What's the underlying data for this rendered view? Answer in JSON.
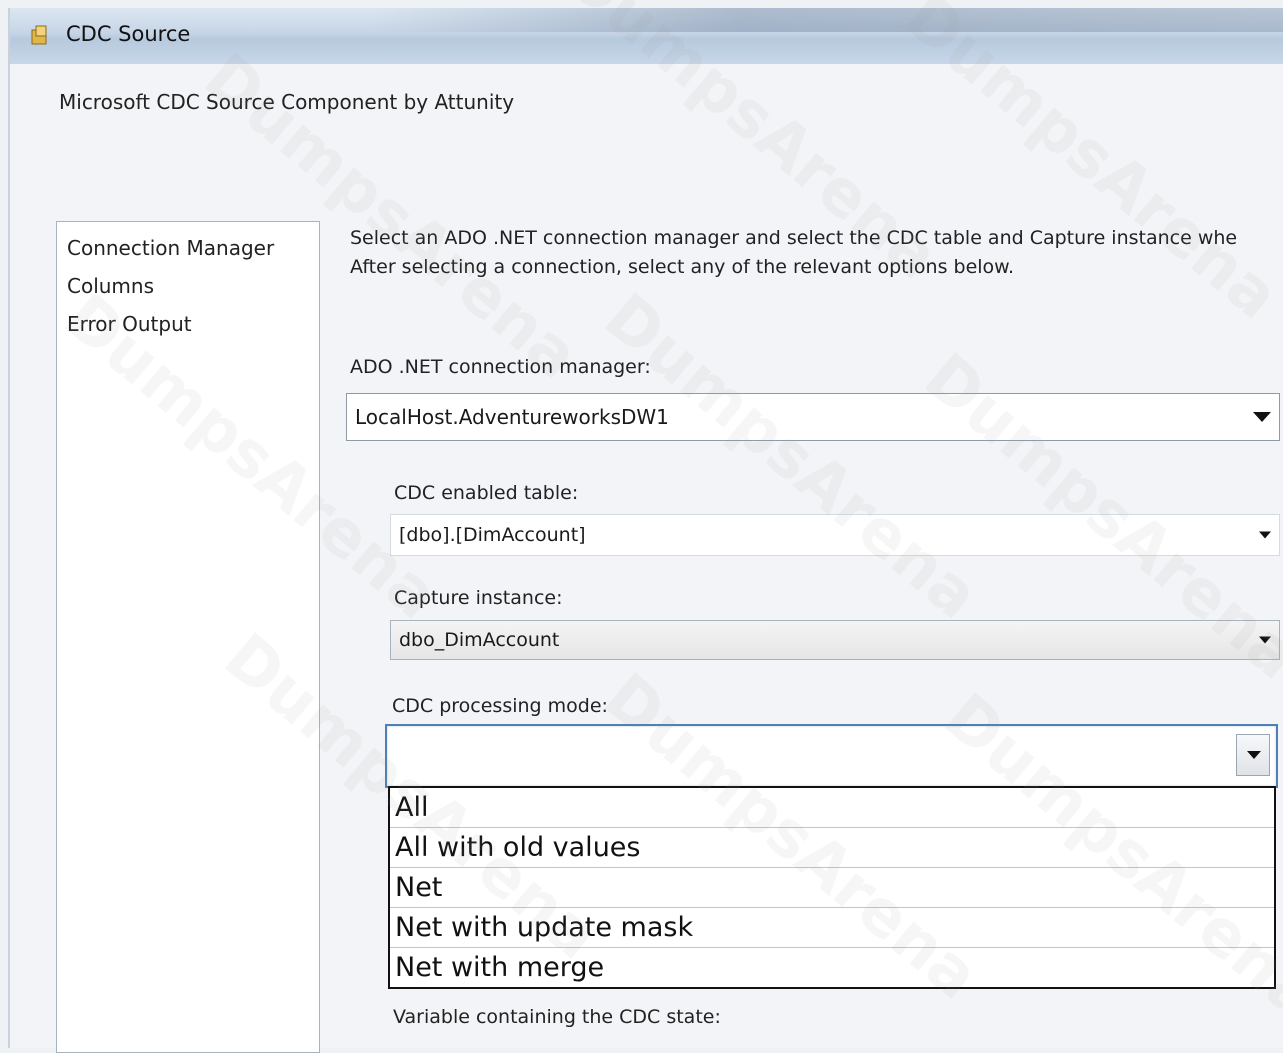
{
  "window": {
    "title": "CDC Source",
    "icon": "ssis-component-icon"
  },
  "component_heading": "Microsoft CDC Source Component by Attunity",
  "nav": {
    "items": [
      {
        "label": "Connection Manager",
        "selected": true
      },
      {
        "label": "Columns",
        "selected": false
      },
      {
        "label": "Error Output",
        "selected": false
      }
    ]
  },
  "instructions": {
    "line1": "Select an ADO .NET connection manager and select the CDC table and Capture instance whe",
    "line2": "After selecting a connection, select any of the relevant options below."
  },
  "connection_manager": {
    "label": "ADO .NET connection manager:",
    "value": "LocalHost.AdventureworksDW1"
  },
  "cdc_table": {
    "label": "CDC enabled table:",
    "value": "[dbo].[DimAccount]"
  },
  "capture_instance": {
    "label": "Capture instance:",
    "value": "dbo_DimAccount"
  },
  "processing_mode": {
    "label": "CDC processing mode:",
    "value": "",
    "options": [
      "All",
      "All with old values",
      "Net",
      "Net with update mask",
      "Net with merge"
    ]
  },
  "state_variable": {
    "label": "Variable containing the CDC state:"
  },
  "watermark": "DumpsArena",
  "colors": {
    "focus_border": "#4f7fb3",
    "panel_bg": "#ffffff",
    "dialog_bg": "#f2f4f7"
  }
}
